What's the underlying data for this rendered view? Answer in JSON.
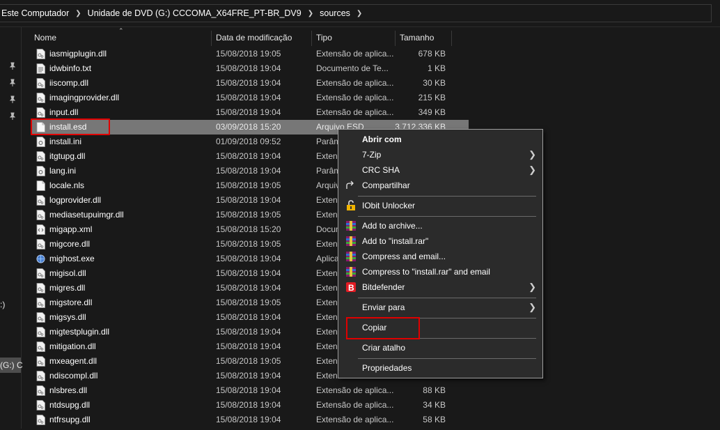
{
  "breadcrumb": [
    "Este Computador",
    "Unidade de DVD (G:) CCCOMA_X64FRE_PT-BR_DV9",
    "sources"
  ],
  "nav": {
    "frag1": ":)",
    "frag2": "(G:) C"
  },
  "columns": {
    "name": "Nome",
    "date": "Data de modificação",
    "type": "Tipo",
    "size": "Tamanho"
  },
  "files": [
    {
      "name": "iasmigplugin.dll",
      "date": "15/08/2018 19:05",
      "type": "Extensão de aplica...",
      "size": "678 KB",
      "icon": "dll-file-icon"
    },
    {
      "name": "idwbinfo.txt",
      "date": "15/08/2018 19:04",
      "type": "Documento de Te...",
      "size": "1 KB",
      "icon": "text-file-icon"
    },
    {
      "name": "iiscomp.dll",
      "date": "15/08/2018 19:04",
      "type": "Extensão de aplica...",
      "size": "30 KB",
      "icon": "dll-file-icon"
    },
    {
      "name": "imagingprovider.dll",
      "date": "15/08/2018 19:04",
      "type": "Extensão de aplica...",
      "size": "215 KB",
      "icon": "dll-file-icon"
    },
    {
      "name": "input.dll",
      "date": "15/08/2018 19:04",
      "type": "Extensão de aplica...",
      "size": "349 KB",
      "icon": "dll-file-icon"
    },
    {
      "name": "install.esd",
      "date": "03/09/2018 15:20",
      "type": "Arquivo ESD",
      "size": "3.712.336 KB",
      "icon": "generic-file-icon"
    },
    {
      "name": "install.ini",
      "date": "01/09/2018 09:52",
      "type": "Parâm",
      "size": "",
      "icon": "ini-file-icon"
    },
    {
      "name": "itgtupg.dll",
      "date": "15/08/2018 19:04",
      "type": "Extens",
      "size": "",
      "icon": "dll-file-icon"
    },
    {
      "name": "lang.ini",
      "date": "15/08/2018 19:04",
      "type": "Parâm",
      "size": "",
      "icon": "ini-file-icon"
    },
    {
      "name": "locale.nls",
      "date": "15/08/2018 19:05",
      "type": "Arquiv",
      "size": "",
      "icon": "generic-file-icon"
    },
    {
      "name": "logprovider.dll",
      "date": "15/08/2018 19:04",
      "type": "Extens",
      "size": "",
      "icon": "dll-file-icon"
    },
    {
      "name": "mediasetupuimgr.dll",
      "date": "15/08/2018 19:05",
      "type": "Extens",
      "size": "",
      "icon": "dll-file-icon"
    },
    {
      "name": "migapp.xml",
      "date": "15/08/2018 15:20",
      "type": "Docum",
      "size": "",
      "icon": "xml-file-icon"
    },
    {
      "name": "migcore.dll",
      "date": "15/08/2018 19:05",
      "type": "Extens",
      "size": "",
      "icon": "dll-file-icon"
    },
    {
      "name": "mighost.exe",
      "date": "15/08/2018 19:04",
      "type": "Aplica",
      "size": "",
      "icon": "exe-file-icon"
    },
    {
      "name": "migisol.dll",
      "date": "15/08/2018 19:04",
      "type": "Extens",
      "size": "",
      "icon": "dll-file-icon"
    },
    {
      "name": "migres.dll",
      "date": "15/08/2018 19:04",
      "type": "Extens",
      "size": "",
      "icon": "dll-file-icon"
    },
    {
      "name": "migstore.dll",
      "date": "15/08/2018 19:05",
      "type": "Extens",
      "size": "",
      "icon": "dll-file-icon"
    },
    {
      "name": "migsys.dll",
      "date": "15/08/2018 19:04",
      "type": "Extens",
      "size": "",
      "icon": "dll-file-icon"
    },
    {
      "name": "migtestplugin.dll",
      "date": "15/08/2018 19:04",
      "type": "Extens",
      "size": "",
      "icon": "dll-file-icon"
    },
    {
      "name": "mitigation.dll",
      "date": "15/08/2018 19:04",
      "type": "Extens",
      "size": "",
      "icon": "dll-file-icon"
    },
    {
      "name": "mxeagent.dll",
      "date": "15/08/2018 19:05",
      "type": "Extens",
      "size": "",
      "icon": "dll-file-icon"
    },
    {
      "name": "ndiscompl.dll",
      "date": "15/08/2018 19:04",
      "type": "Extens",
      "size": "",
      "icon": "dll-file-icon"
    },
    {
      "name": "nlsbres.dll",
      "date": "15/08/2018 19:04",
      "type": "Extensão de aplica...",
      "size": "88 KB",
      "icon": "dll-file-icon"
    },
    {
      "name": "ntdsupg.dll",
      "date": "15/08/2018 19:04",
      "type": "Extensão de aplica...",
      "size": "34 KB",
      "icon": "dll-file-icon"
    },
    {
      "name": "ntfrsupg.dll",
      "date": "15/08/2018 19:04",
      "type": "Extensão de aplica...",
      "size": "58 KB",
      "icon": "dll-file-icon"
    }
  ],
  "selected_file": "install.esd",
  "context_menu": {
    "open_with": "Abrir com",
    "seven_zip": "7-Zip",
    "crc_sha": "CRC SHA",
    "share": "Compartilhar",
    "iobit": "IObit Unlocker",
    "add_archive": "Add to archive...",
    "add_rar": "Add to \"install.rar\"",
    "compress_email": "Compress and email...",
    "compress_rar_email": "Compress to \"install.rar\" and email",
    "bitdefender": "Bitdefender",
    "send_to": "Enviar para",
    "copy": "Copiar",
    "shortcut": "Criar atalho",
    "properties": "Propriedades"
  },
  "colors": {
    "highlight": "#e00000",
    "selected_row": "#777777",
    "menu_bg": "#2b2b2b",
    "window_bg": "#191919"
  }
}
